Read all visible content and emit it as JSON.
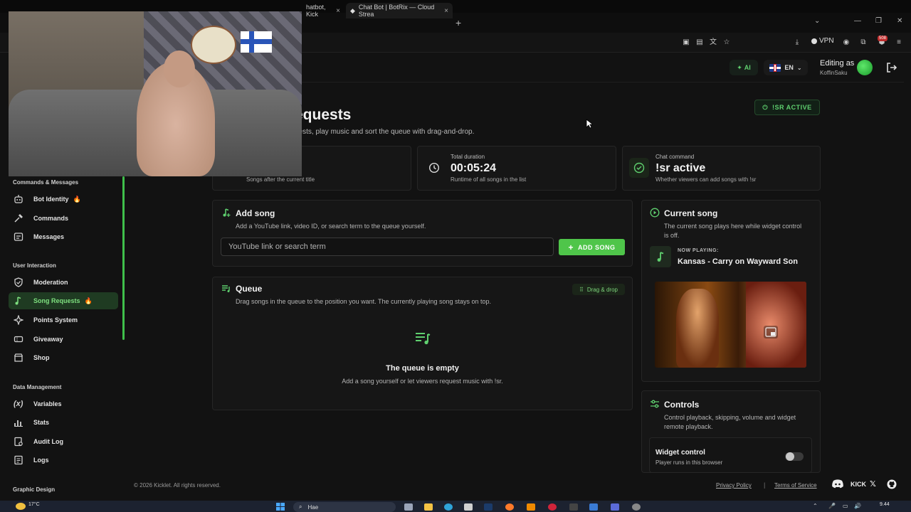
{
  "browser": {
    "tabs": [
      {
        "label": "hatbot, Kick",
        "close": "×"
      },
      {
        "label": "Chat Bot | BotRix — Cloud Strea",
        "close": "×"
      }
    ],
    "new_tab": "+",
    "vpn_label": "VPN",
    "extensions_badge": "508"
  },
  "header": {
    "ai_label": "AI",
    "language": "EN",
    "editing_as": "Editing as",
    "username": "KoffinSaku"
  },
  "sidebar": {
    "sections": [
      {
        "title": "Commands & Messages",
        "items": [
          {
            "label": "Bot Identity",
            "badge": "🔥"
          },
          {
            "label": "Commands"
          },
          {
            "label": "Messages"
          }
        ]
      },
      {
        "title": "User Interaction",
        "items": [
          {
            "label": "Moderation"
          },
          {
            "label": "Song Requests",
            "badge": "🔥",
            "active": true
          },
          {
            "label": "Points System"
          },
          {
            "label": "Giveaway"
          },
          {
            "label": "Shop"
          }
        ]
      },
      {
        "title": "Data Management",
        "items": [
          {
            "label": "Variables"
          },
          {
            "label": "Stats"
          },
          {
            "label": "Audit Log"
          },
          {
            "label": "Logs"
          }
        ]
      },
      {
        "title": "Graphic Design",
        "items": []
      }
    ]
  },
  "page": {
    "title": "equests",
    "subtitle": "uests, play music and sort the queue with drag-and-drop.",
    "status_pill": "!SR ACTIVE"
  },
  "stats": [
    {
      "label": "",
      "value": "",
      "desc": "Songs after the current title"
    },
    {
      "label": "Total duration",
      "value": "00:05:24",
      "desc": "Runtime of all songs in the list"
    },
    {
      "label": "Chat command",
      "value": "!sr active",
      "desc": "Whether viewers can add songs with !sr"
    }
  ],
  "add_song": {
    "title": "Add song",
    "desc": "Add a YouTube link, video ID, or search term to the queue yourself.",
    "placeholder": "YouTube link or search term",
    "button": "ADD SONG"
  },
  "queue": {
    "title": "Queue",
    "desc": "Drag songs in the queue to the position you want. The currently playing song stays on top.",
    "drag_label": "Drag & drop",
    "empty_title": "The queue is empty",
    "empty_desc": "Add a song yourself or let viewers request music with !sr."
  },
  "current_song": {
    "title": "Current song",
    "desc": "The current song plays here while widget control is off.",
    "now_playing_label": "NOW PLAYING:",
    "song": "Kansas - Carry on Wayward Son"
  },
  "controls": {
    "title": "Controls",
    "desc": "Control playback, skipping, volume and widget remote playback.",
    "widget_title": "Widget control",
    "widget_desc": "Player runs in this browser",
    "widget_enabled": false
  },
  "footer": {
    "copyright": "© 2026 Kicklet. All rights reserved.",
    "privacy": "Privacy Policy",
    "separator": "|",
    "terms": "Terms of Service",
    "kick": "KICK"
  },
  "taskbar": {
    "weather": "17°C",
    "search": "Hae",
    "time": "9.44"
  },
  "colors": {
    "accent": "#4fc54a",
    "background": "#121212",
    "card": "#161616"
  }
}
